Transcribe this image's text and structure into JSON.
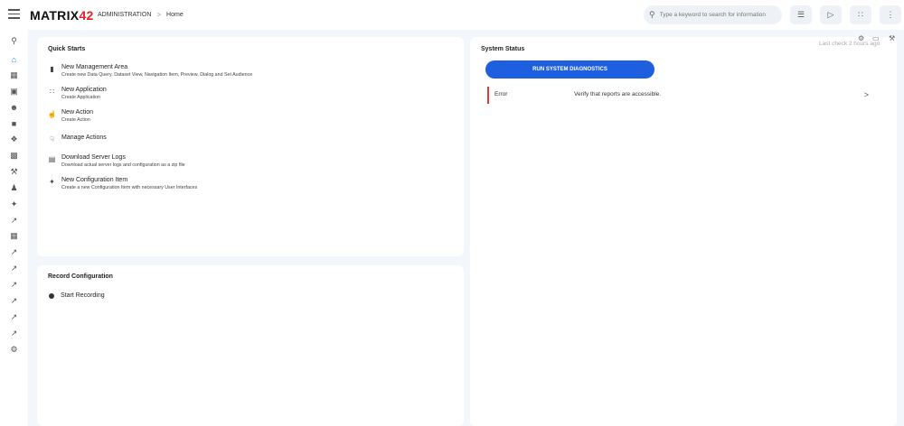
{
  "header": {
    "logo_text": "MATRIX",
    "logo_num": "42",
    "breadcrumb": [
      "ADMINISTRATION",
      "Home"
    ],
    "breadcrumb_sep": ">",
    "search_placeholder": "Type a keyword to search for information"
  },
  "sidebar": {
    "items": [
      "search",
      "home",
      "dashboard",
      "lock",
      "people",
      "admin",
      "hierarchy",
      "contacts",
      "wrench",
      "accessibility",
      "puzzle",
      "open-external",
      "grid",
      "open-external",
      "open-external",
      "open-external",
      "open-external",
      "open-external",
      "open-external",
      "settings"
    ]
  },
  "quick_starts": {
    "title": "Quick Starts",
    "items": [
      {
        "icon": "management-area-icon",
        "title": "New Management Area",
        "desc": "Create new Data Query, Dataset View, Navigation Item, Preview, Dialog and Set Audience"
      },
      {
        "icon": "app-grid-icon",
        "title": "New Application",
        "desc": "Create Application"
      },
      {
        "icon": "action-add-icon",
        "title": "New Action",
        "desc": "Create Action"
      },
      {
        "icon": "manage-actions-icon",
        "title": "Manage Actions",
        "desc": ""
      },
      {
        "icon": "download-logs-icon",
        "title": "Download Server Logs",
        "desc": "Download actual server logs and configuration as a zip file"
      },
      {
        "icon": "config-item-icon",
        "title": "New Configuration Item",
        "desc": "Create a new Configuration Item with necessary User Interfaces"
      }
    ]
  },
  "record_configuration": {
    "title": "Record Configuration",
    "start_label": "Start Recording"
  },
  "system_status": {
    "title": "System Status",
    "run_button": "RUN SYSTEM DIAGNOSTICS",
    "last_check": "Last check 2 hours ago",
    "row": {
      "label": "Error",
      "message": "Verify that reports are accessible.",
      "chevron": ">"
    }
  },
  "colors": {
    "accent": "#1e5fe0",
    "error": "#e53935",
    "brand_red": "#e31e24"
  }
}
